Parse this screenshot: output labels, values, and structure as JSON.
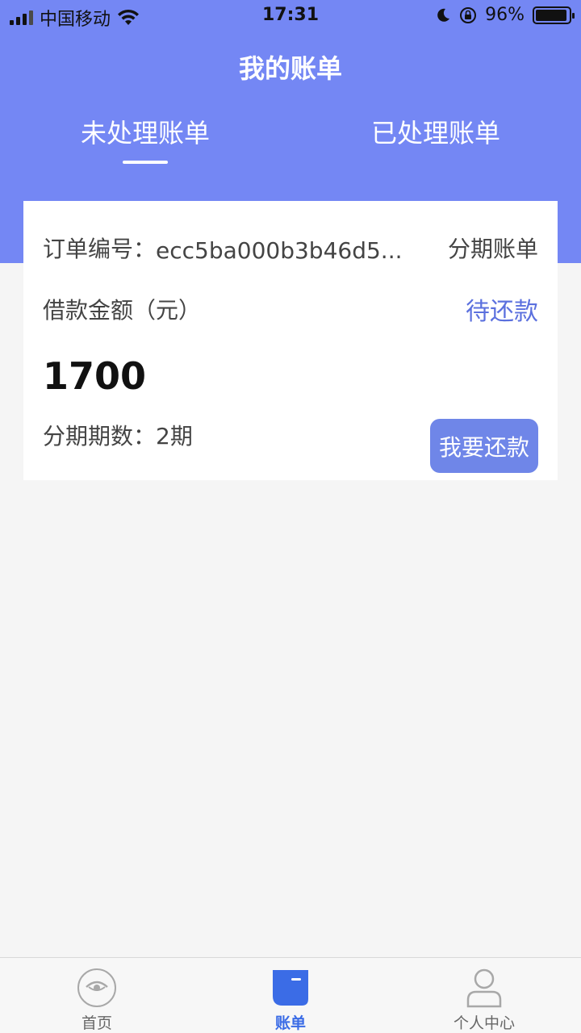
{
  "status_bar": {
    "carrier": "中国移动",
    "time": "17:31",
    "battery_level": "96%",
    "battery_fraction": 0.96
  },
  "header": {
    "title": "我的账单",
    "tabs": [
      {
        "label": "未处理账单",
        "active": true
      },
      {
        "label": "已处理账单",
        "active": false
      }
    ]
  },
  "bill_card": {
    "order_label": "订单编号：",
    "order_number": "ecc5ba000b3b46d5...",
    "bill_type": "分期账单",
    "amount_label": "借款金额（元）",
    "status": "待还款",
    "amount": "1700",
    "period_label": "分期期数：",
    "period_value": "2期",
    "repay_button": "我要还款"
  },
  "tab_bar": {
    "items": [
      {
        "label": "首页",
        "icon": "home-eye-icon",
        "active": false
      },
      {
        "label": "账单",
        "icon": "bill-icon",
        "active": true
      },
      {
        "label": "个人中心",
        "icon": "person-icon",
        "active": false
      }
    ]
  },
  "colors": {
    "header_bg": "#7487f4",
    "accent": "#5b70de",
    "button_bg": "#6f86e8",
    "tab_active": "#3b6ce6"
  }
}
